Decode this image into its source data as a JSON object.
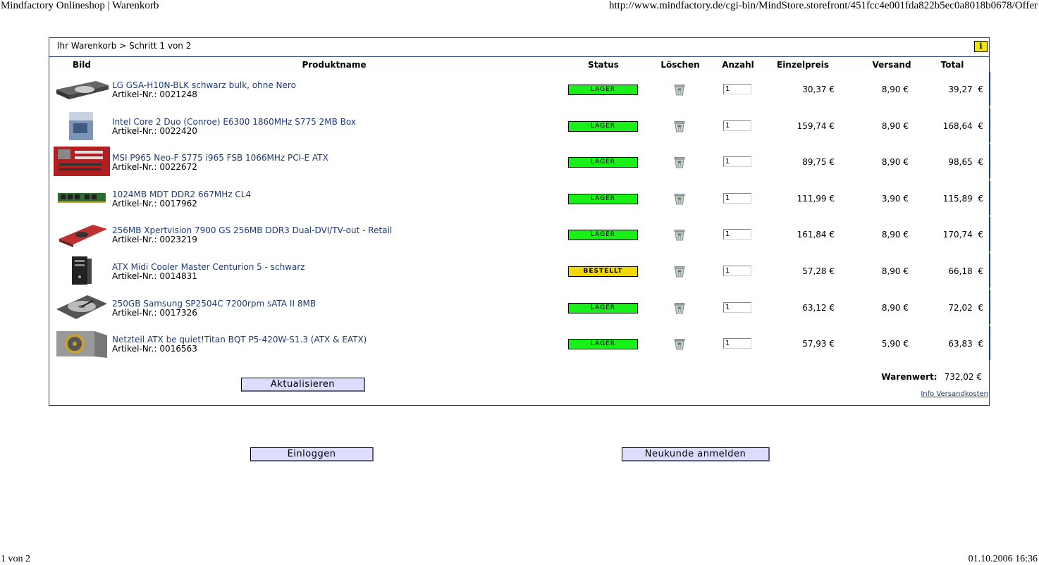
{
  "print_header": {
    "title": "Mindfactory Onlineshop | Warenkorb",
    "url": "http://www.mindfactory.de/cgi-bin/MindStore.storefront/451fcc4e001fda822b5ec0a8018b0678/Offer"
  },
  "print_footer": {
    "page": "1 von 2",
    "datetime": "01.10.2006 16:36"
  },
  "cart": {
    "breadcrumb": "Ihr Warenkorb > Schritt 1 von 2",
    "info_icon_label": "i",
    "columns": {
      "image": "Bild",
      "product": "Produktname",
      "status": "Status",
      "delete": "Löschen",
      "quantity": "Anzahl",
      "unit_price": "Einzelpreis",
      "shipping": "Versand",
      "total": "Total"
    },
    "article_prefix": "Artikel-Nr.:",
    "items": [
      {
        "name": "LG GSA-H10N-BLK schwarz bulk, ohne Nero",
        "article": "0021248",
        "status": "LAGER",
        "status_kind": "lager",
        "qty": "1",
        "unit_price": "30,37 €",
        "shipping": "8,90 €",
        "total": "39,27  €",
        "thumb": "drive-icon"
      },
      {
        "name": "Intel Core 2 Duo (Conroe) E6300 1860MHz S775 2MB Box",
        "article": "0022420",
        "status": "LAGER",
        "status_kind": "lager",
        "qty": "1",
        "unit_price": "159,74 €",
        "shipping": "8,90 €",
        "total": "168,64  €",
        "thumb": "cpu-box-icon"
      },
      {
        "name": "MSI P965 Neo-F S775 i965 FSB 1066MHz PCI-E ATX",
        "article": "0022672",
        "status": "LAGER",
        "status_kind": "lager",
        "qty": "1",
        "unit_price": "89,75 €",
        "shipping": "8,90 €",
        "total": "98,65  €",
        "thumb": "mainboard-icon"
      },
      {
        "name": "1024MB MDT DDR2 667MHz CL4",
        "article": "0017962",
        "status": "LAGER",
        "status_kind": "lager",
        "qty": "1",
        "unit_price": "111,99 €",
        "shipping": "3,90 €",
        "total": "115,89  €",
        "thumb": "ram-icon"
      },
      {
        "name": "256MB Xpertvision 7900 GS 256MB DDR3 Dual-DVI/TV-out - Retail",
        "article": "0023219",
        "status": "LAGER",
        "status_kind": "lager",
        "qty": "1",
        "unit_price": "161,84 €",
        "shipping": "8,90 €",
        "total": "170,74  €",
        "thumb": "graphics-card-icon"
      },
      {
        "name": "ATX Midi Cooler Master Centurion 5 - schwarz",
        "article": "0014831",
        "status": "BESTELLT",
        "status_kind": "bestellt",
        "qty": "1",
        "unit_price": "57,28 €",
        "shipping": "8,90 €",
        "total": "66,18  €",
        "thumb": "pc-case-icon"
      },
      {
        "name": "250GB Samsung SP2504C 7200rpm sATA II 8MB",
        "article": "0017326",
        "status": "LAGER",
        "status_kind": "lager",
        "qty": "1",
        "unit_price": "63,12 €",
        "shipping": "8,90 €",
        "total": "72,02  €",
        "thumb": "hard-drive-icon"
      },
      {
        "name": "Netzteil ATX be quiet!Titan BQT P5-420W-S1.3 (ATX & EATX)",
        "article": "0016563",
        "status": "LAGER",
        "status_kind": "lager",
        "qty": "1",
        "unit_price": "57,93 €",
        "shipping": "5,90 €",
        "total": "63,83  €",
        "thumb": "power-supply-icon"
      }
    ],
    "update_button": "Aktualisieren",
    "warenwert_label": "Warenwert:",
    "warenwert_value": "732,02  €",
    "shipping_info_link": "Info Versandkosten"
  },
  "actions": {
    "login_button": "Einloggen",
    "register_button": "Neukunde anmelden"
  },
  "colors": {
    "frame": "#1e3a78",
    "status_lager": "#18f018",
    "status_bestellt": "#f0d800",
    "button_bg": "#dcdcfc",
    "info_icon": "#f2e600"
  }
}
